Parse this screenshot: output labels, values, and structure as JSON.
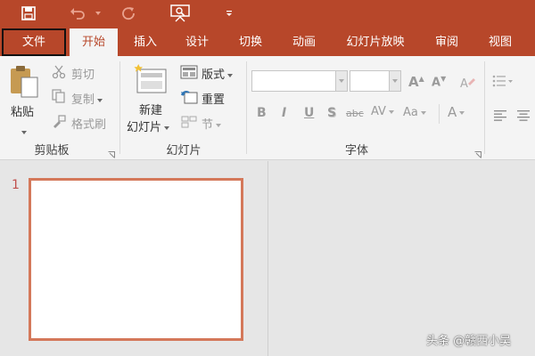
{
  "quick_access": {
    "icons": [
      "save-icon",
      "undo-icon",
      "redo-icon",
      "presenter-icon",
      "customize-icon"
    ]
  },
  "tabs": [
    {
      "label": "文件"
    },
    {
      "label": "开始"
    },
    {
      "label": "插入"
    },
    {
      "label": "设计"
    },
    {
      "label": "切换"
    },
    {
      "label": "动画"
    },
    {
      "label": "幻灯片放映"
    },
    {
      "label": "审阅"
    },
    {
      "label": "视图"
    }
  ],
  "active_tab": "开始",
  "ribbon": {
    "clipboard": {
      "paste": "粘贴",
      "cut": "剪切",
      "copy": "复制",
      "format_painter": "格式刷",
      "group_label": "剪贴板"
    },
    "slides": {
      "new_slide_1": "新建",
      "new_slide_2": "幻灯片",
      "layout": "版式",
      "reset": "重置",
      "section": "节",
      "group_label": "幻灯片"
    },
    "font": {
      "group_label": "字体",
      "bold": "B",
      "italic": "I",
      "underline": "U",
      "shadow": "S",
      "strike": "abc",
      "spacing": "AV",
      "case": "Aa",
      "color": "A",
      "grow": "A",
      "shrink": "A"
    }
  },
  "slide_pane": {
    "slide_number": "1"
  },
  "watermark": "头条 @赣西小吴",
  "colors": {
    "accent": "#b7472a",
    "thumb_border": "#d4785a"
  }
}
